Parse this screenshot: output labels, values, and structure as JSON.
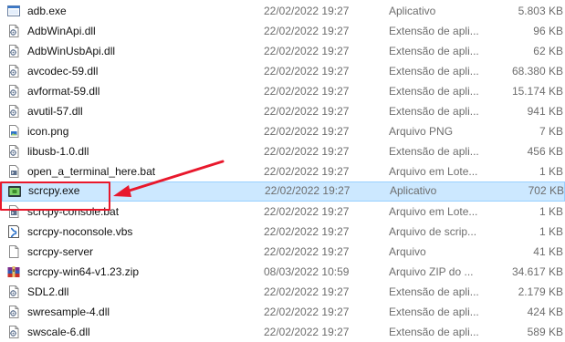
{
  "files": [
    {
      "name": "adb.exe",
      "date": "22/02/2022 19:27",
      "type": "Aplicativo",
      "size": "5.803 KB",
      "icon": "exe-icon"
    },
    {
      "name": "AdbWinApi.dll",
      "date": "22/02/2022 19:27",
      "type": "Extensão de apli...",
      "size": "96 KB",
      "icon": "dll-icon"
    },
    {
      "name": "AdbWinUsbApi.dll",
      "date": "22/02/2022 19:27",
      "type": "Extensão de apli...",
      "size": "62 KB",
      "icon": "dll-icon"
    },
    {
      "name": "avcodec-59.dll",
      "date": "22/02/2022 19:27",
      "type": "Extensão de apli...",
      "size": "68.380 KB",
      "icon": "dll-icon"
    },
    {
      "name": "avformat-59.dll",
      "date": "22/02/2022 19:27",
      "type": "Extensão de apli...",
      "size": "15.174 KB",
      "icon": "dll-icon"
    },
    {
      "name": "avutil-57.dll",
      "date": "22/02/2022 19:27",
      "type": "Extensão de apli...",
      "size": "941 KB",
      "icon": "dll-icon"
    },
    {
      "name": "icon.png",
      "date": "22/02/2022 19:27",
      "type": "Arquivo PNG",
      "size": "7 KB",
      "icon": "image-file-icon"
    },
    {
      "name": "libusb-1.0.dll",
      "date": "22/02/2022 19:27",
      "type": "Extensão de apli...",
      "size": "456 KB",
      "icon": "dll-icon"
    },
    {
      "name": "open_a_terminal_here.bat",
      "date": "22/02/2022 19:27",
      "type": "Arquivo em Lote...",
      "size": "1 KB",
      "icon": "bat-icon"
    },
    {
      "name": "scrcpy.exe",
      "date": "22/02/2022 19:27",
      "type": "Aplicativo",
      "size": "702 KB",
      "icon": "scrcpy-app-icon",
      "selected": true
    },
    {
      "name": "scrcpy-console.bat",
      "date": "22/02/2022 19:27",
      "type": "Arquivo em Lote...",
      "size": "1 KB",
      "icon": "bat-icon"
    },
    {
      "name": "scrcpy-noconsole.vbs",
      "date": "22/02/2022 19:27",
      "type": "Arquivo de scrip...",
      "size": "1 KB",
      "icon": "vbs-icon"
    },
    {
      "name": "scrcpy-server",
      "date": "22/02/2022 19:27",
      "type": "Arquivo",
      "size": "41 KB",
      "icon": "blank-file-icon"
    },
    {
      "name": "scrcpy-win64-v1.23.zip",
      "date": "08/03/2022 10:59",
      "type": "Arquivo ZIP do ...",
      "size": "34.617 KB",
      "icon": "zip-icon"
    },
    {
      "name": "SDL2.dll",
      "date": "22/02/2022 19:27",
      "type": "Extensão de apli...",
      "size": "2.179 KB",
      "icon": "dll-icon"
    },
    {
      "name": "swresample-4.dll",
      "date": "22/02/2022 19:27",
      "type": "Extensão de apli...",
      "size": "424 KB",
      "icon": "dll-icon"
    },
    {
      "name": "swscale-6.dll",
      "date": "22/02/2022 19:27",
      "type": "Extensão de apli...",
      "size": "589 KB",
      "icon": "dll-icon"
    }
  ],
  "colors": {
    "selection_bg": "#cce8ff",
    "selection_border": "#99d1ff",
    "annotation": "#e8182c"
  }
}
